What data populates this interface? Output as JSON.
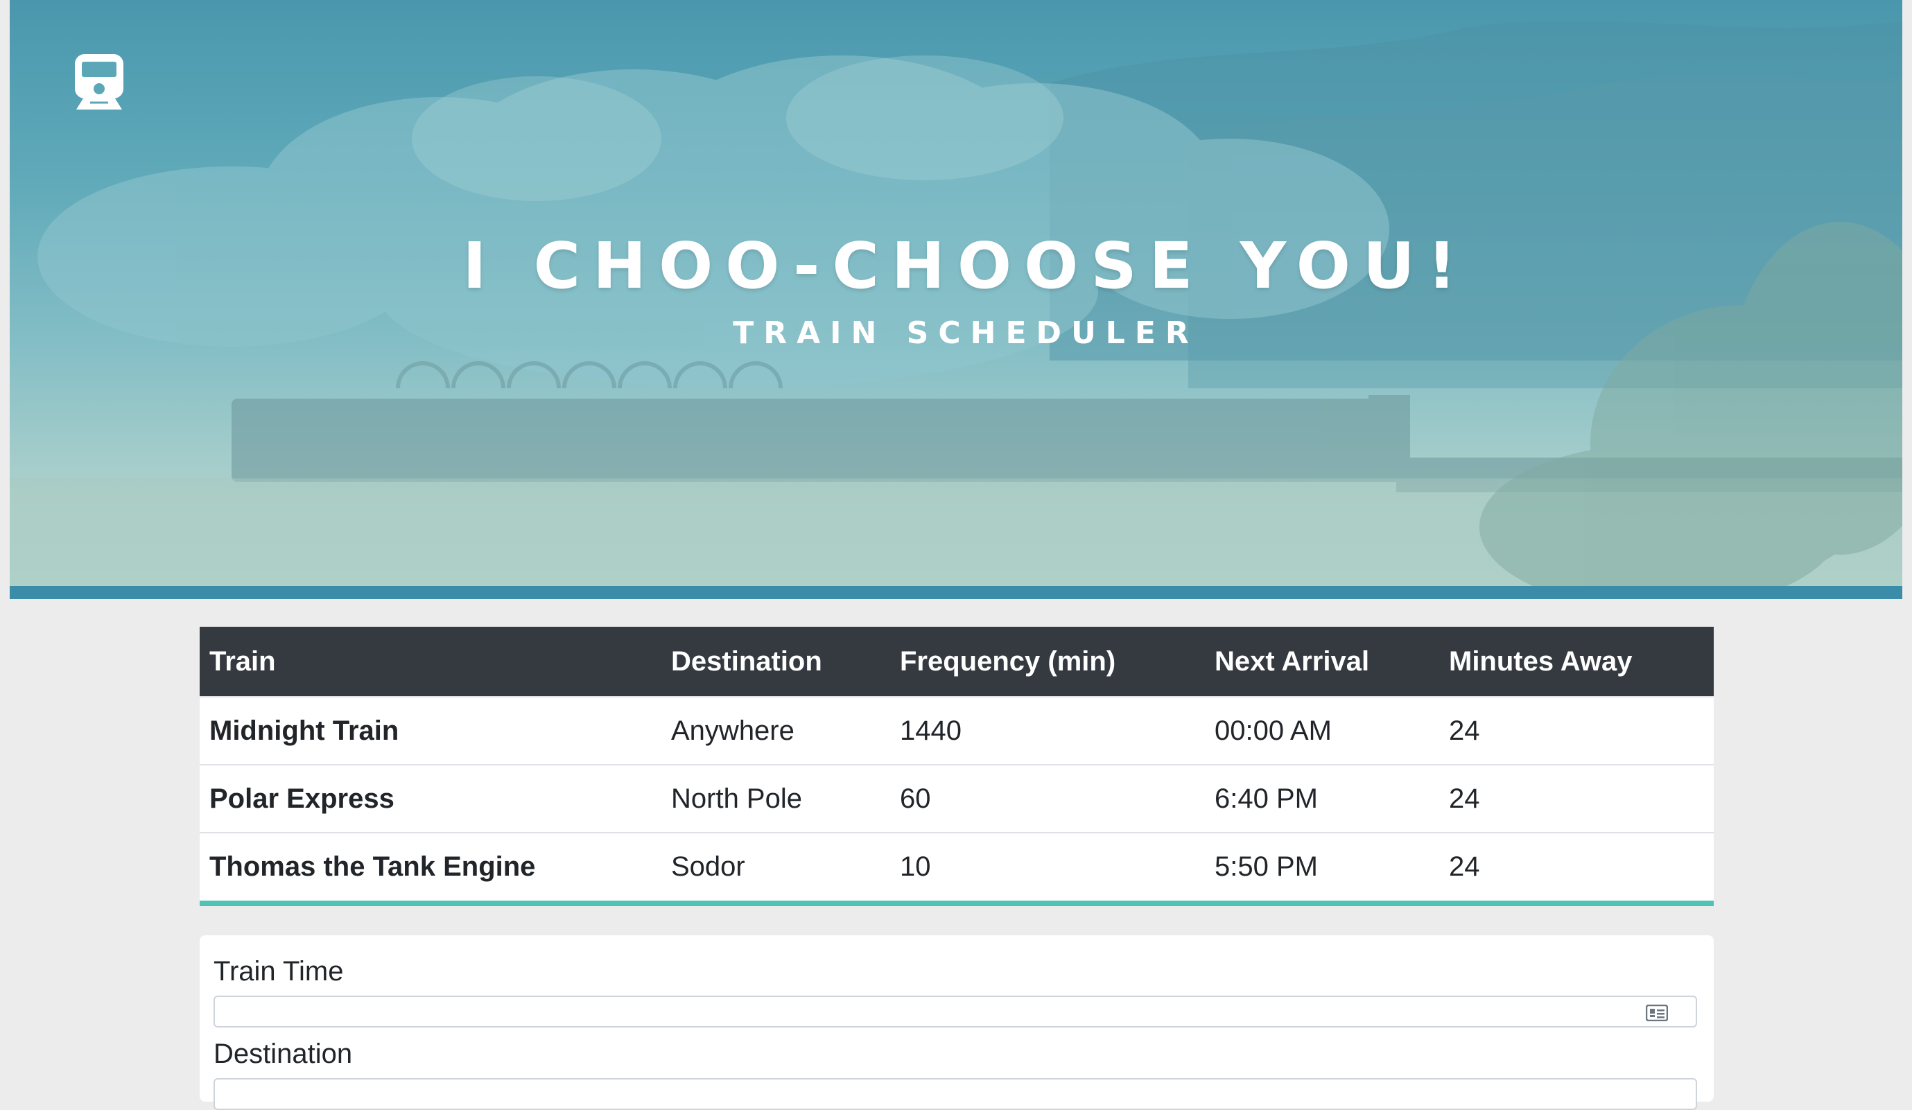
{
  "hero": {
    "logo": "train-icon",
    "title": "I CHOO-CHOOSE YOU!",
    "subtitle": "TRAIN SCHEDULER",
    "colors": {
      "sky": "#4a97ad",
      "bar": "#3a8ca9"
    }
  },
  "schedule": {
    "headers": [
      "Train",
      "Destination",
      "Frequency (min)",
      "Next Arrival",
      "Minutes Away"
    ],
    "rows": [
      {
        "train": "Midnight Train",
        "destination": "Anywhere",
        "frequency": "1440",
        "next_arrival": "00:00 AM",
        "minutes_away": "24"
      },
      {
        "train": "Polar Express",
        "destination": "North Pole",
        "frequency": "60",
        "next_arrival": "6:40 PM",
        "minutes_away": "24"
      },
      {
        "train": "Thomas the Tank Engine",
        "destination": "Sodor",
        "frequency": "10",
        "next_arrival": "5:50 PM",
        "minutes_away": "24"
      }
    ],
    "colors": {
      "header_bg": "#343a40",
      "accent": "#4ec3b4"
    }
  },
  "form": {
    "train_time_label": "Train Time",
    "train_time_value": "",
    "train_time_icon": "contact-card-icon",
    "destination_label": "Destination",
    "destination_value": ""
  }
}
